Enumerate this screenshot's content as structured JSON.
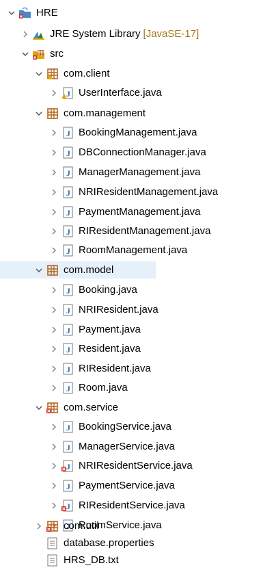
{
  "tree": {
    "project": {
      "label": "HRE"
    },
    "jre": {
      "label": "JRE System Library",
      "decoration": "[JavaSE-17]"
    },
    "src": {
      "label": "src"
    },
    "packages": [
      {
        "label": "com.client",
        "files": [
          {
            "label": "UserInterface.java",
            "error": false,
            "warning": true
          }
        ]
      },
      {
        "label": "com.management",
        "files": [
          {
            "label": "BookingManagement.java"
          },
          {
            "label": "DBConnectionManager.java"
          },
          {
            "label": "ManagerManagement.java"
          },
          {
            "label": "NRIResidentManagement.java"
          },
          {
            "label": "PaymentManagement.java"
          },
          {
            "label": "RIResidentManagement.java"
          },
          {
            "label": "RoomManagement.java"
          }
        ]
      },
      {
        "label": "com.model",
        "selected": true,
        "files": [
          {
            "label": "Booking.java"
          },
          {
            "label": "NRIResident.java"
          },
          {
            "label": "Payment.java"
          },
          {
            "label": "Resident.java"
          },
          {
            "label": "RIResident.java"
          },
          {
            "label": "Room.java"
          }
        ]
      },
      {
        "label": "com.service",
        "error": true,
        "files": [
          {
            "label": "BookingService.java"
          },
          {
            "label": "ManagerService.java"
          },
          {
            "label": "NRIResidentService.java",
            "error": true
          },
          {
            "label": "PaymentService.java"
          },
          {
            "label": "RIResidentService.java",
            "error": true
          },
          {
            "label": "RoomService.java"
          }
        ]
      },
      {
        "label": "com.util",
        "error": true,
        "collapsed": true
      }
    ],
    "files": [
      {
        "label": "database.properties"
      },
      {
        "label": "HRS_DB.txt"
      }
    ]
  },
  "colors": {
    "package": "#b5651d",
    "jfile": "#2f6fb8",
    "error": "#d32f2f",
    "warning": "#e0a800",
    "decoration": "#a3781d",
    "selection": "#e5f0fb"
  }
}
